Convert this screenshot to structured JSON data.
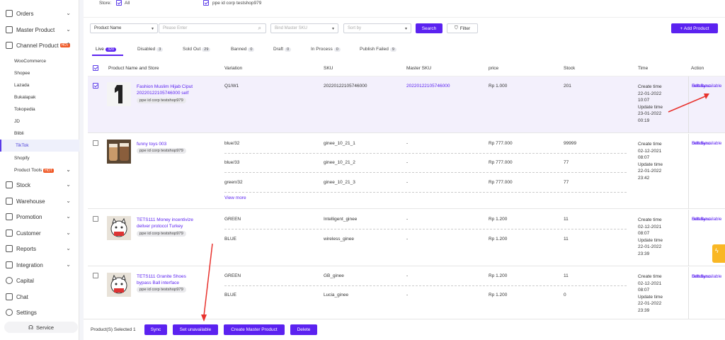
{
  "sidebar": {
    "main_top": [
      {
        "label": "Orders",
        "icon": "cart-icon"
      },
      {
        "label": "Master Product",
        "icon": "box-icon"
      },
      {
        "label": "Channel Product",
        "icon": "channel-icon",
        "badge": "HOT"
      }
    ],
    "channels": [
      "WooCommerce",
      "Shopee",
      "Lazada",
      "Bukalapak",
      "Tokopedia",
      "JD",
      "Blibli",
      "TikTok",
      "Shopify"
    ],
    "product_tools": {
      "label": "Product Tools",
      "badge": "HOT"
    },
    "main_bottom": [
      {
        "label": "Stock",
        "icon": "stock-icon"
      },
      {
        "label": "Warehouse",
        "icon": "truck-icon"
      },
      {
        "label": "Promotion",
        "icon": "tag-icon"
      },
      {
        "label": "Customer",
        "icon": "users-icon"
      },
      {
        "label": "Reports",
        "icon": "chart-icon"
      },
      {
        "label": "Integration",
        "icon": "link-icon"
      },
      {
        "label": "Capital",
        "icon": "dollar-icon"
      },
      {
        "label": "Chat",
        "icon": "chat-icon"
      },
      {
        "label": "Settings",
        "icon": "gear-icon"
      }
    ],
    "service": "Service"
  },
  "store": {
    "label": "Store:",
    "all": "All",
    "shop": "ppe id corp testshop979"
  },
  "filters": {
    "field": "Product Name",
    "placeholder": "Please Enter",
    "master_sku": "Bind Master SKU",
    "sort": "Sort by",
    "search": "Search",
    "filter": "Filter",
    "add": "+ Add Product"
  },
  "tabs": [
    {
      "label": "Live",
      "count": "320"
    },
    {
      "label": "Disabled",
      "count": "3"
    },
    {
      "label": "Sold Out",
      "count": "29"
    },
    {
      "label": "Banned",
      "count": "0"
    },
    {
      "label": "Draft",
      "count": "0"
    },
    {
      "label": "In Process",
      "count": "0"
    },
    {
      "label": "Publish Failed",
      "count": "9"
    }
  ],
  "columns": [
    "Product Name and Store",
    "Variation",
    "SKU",
    "Master SKU",
    "price",
    "Stock",
    "Time",
    "Action"
  ],
  "products": [
    {
      "name": "Fashion Muslim Hijab Ciput 20220122105746000 self",
      "store": "ppe id corp testshop979",
      "variants": [
        {
          "var": "Q1/W1",
          "sku": "20220122105746000",
          "master": "20220122105746000",
          "price": "Rp 1.000",
          "stock": "201"
        }
      ],
      "create_label": "Create time",
      "create": "22-01-2022 10:07",
      "update_label": "Update time",
      "update": "23-01-2022 00:19"
    },
    {
      "name": "funny toys 003",
      "store": "ppe id corp testshop979",
      "variants": [
        {
          "var": "blue/32",
          "sku": "ginee_10_21_1",
          "master": "-",
          "price": "Rp 777.000",
          "stock": "99999"
        },
        {
          "var": "blue/33",
          "sku": "ginee_10_21_2",
          "master": "-",
          "price": "Rp 777.000",
          "stock": "77"
        },
        {
          "var": "green/32",
          "sku": "ginee_10_21_3",
          "master": "-",
          "price": "Rp 777.000",
          "stock": "77"
        }
      ],
      "view_more": "View more",
      "create_label": "Create time",
      "create": "02-12-2021 08:07",
      "update_label": "Update time",
      "update": "22-01-2022 23:42"
    },
    {
      "name": "TETS111 Money incentivize deliver protocol Turkey",
      "store": "ppe id corp testshop979",
      "variants": [
        {
          "var": "GREEN",
          "sku": "Intelligent_ginee",
          "master": "-",
          "price": "Rp 1.200",
          "stock": "11"
        },
        {
          "var": "BLUE",
          "sku": "wireless_ginee",
          "master": "-",
          "price": "Rp 1.200",
          "stock": "11"
        }
      ],
      "create_label": "Create time",
      "create": "02-12-2021 08:07",
      "update_label": "Update time",
      "update": "22-01-2022 23:39"
    },
    {
      "name": "TETS111 Granite Shoes bypass Ball interface",
      "store": "ppe id corp testshop979",
      "variants": [
        {
          "var": "GREEN",
          "sku": "GB_ginee",
          "master": "-",
          "price": "Rp 1.200",
          "stock": "11"
        },
        {
          "var": "BLUE",
          "sku": "Lucia_ginee",
          "master": "-",
          "price": "Rp 1.200",
          "stock": "0"
        }
      ],
      "create_label": "Create time",
      "create": "02-12-2021 08:07",
      "update_label": "Update time",
      "update": "22-01-2022 23:39"
    }
  ],
  "actions": {
    "edit": "Edit Sync",
    "unavail": "Set unavailable",
    "delete": "Delete"
  },
  "bottom": {
    "selected": "Product(S) Selected 1",
    "sync": "Sync",
    "unavail": "Set unavailable",
    "create_master": "Create Master Product",
    "delete": "Delete"
  },
  "colors": {
    "accent": "#5b22f0",
    "annotation": "#e8322d",
    "float": "#f9b724"
  }
}
